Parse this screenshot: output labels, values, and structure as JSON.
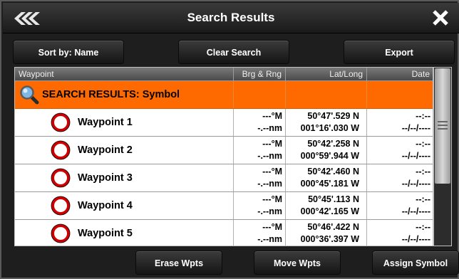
{
  "window": {
    "title": "Search Results"
  },
  "toolbar": {
    "sort_label": "Sort by: Name",
    "clear_label": "Clear Search",
    "export_label": "Export"
  },
  "table": {
    "columns": [
      "Waypoint",
      "Brg & Rng",
      "Lat/Long",
      "Date"
    ],
    "group_label": "SEARCH RESULTS: Symbol",
    "rows": [
      {
        "name": "Waypoint 1",
        "brg": "---°M",
        "rng": "-.--nm",
        "lat": "50°47'.529 N",
        "lon": "001°16'.030 W",
        "time": "--:--",
        "date": "--/--/----"
      },
      {
        "name": "Waypoint 2",
        "brg": "---°M",
        "rng": "-.--nm",
        "lat": "50°42'.258 N",
        "lon": "000°59'.944 W",
        "time": "--:--",
        "date": "--/--/----"
      },
      {
        "name": "Waypoint 3",
        "brg": "---°M",
        "rng": "-.--nm",
        "lat": "50°42'.460 N",
        "lon": "000°45'.181 W",
        "time": "--:--",
        "date": "--/--/----"
      },
      {
        "name": "Waypoint 4",
        "brg": "---°M",
        "rng": "-.--nm",
        "lat": "50°45'.113 N",
        "lon": "000°42'.165 W",
        "time": "--:--",
        "date": "--/--/----"
      },
      {
        "name": "Waypoint 5",
        "brg": "---°M",
        "rng": "-.--nm",
        "lat": "50°46'.422 N",
        "lon": "000°36'.397 W",
        "time": "--:--",
        "date": "--/--/----"
      }
    ]
  },
  "actions": {
    "erase_label": "Erase Wpts",
    "move_label": "Move Wpts",
    "assign_label": "Assign Symbol"
  },
  "colors": {
    "group_row": "#ff6a00",
    "waypoint_ring": "#d00000"
  },
  "icons": {
    "back": "back-chevrons-icon",
    "close": "close-icon",
    "group": "magnifier-icon",
    "waypoint": "waypoint-ring-icon"
  }
}
